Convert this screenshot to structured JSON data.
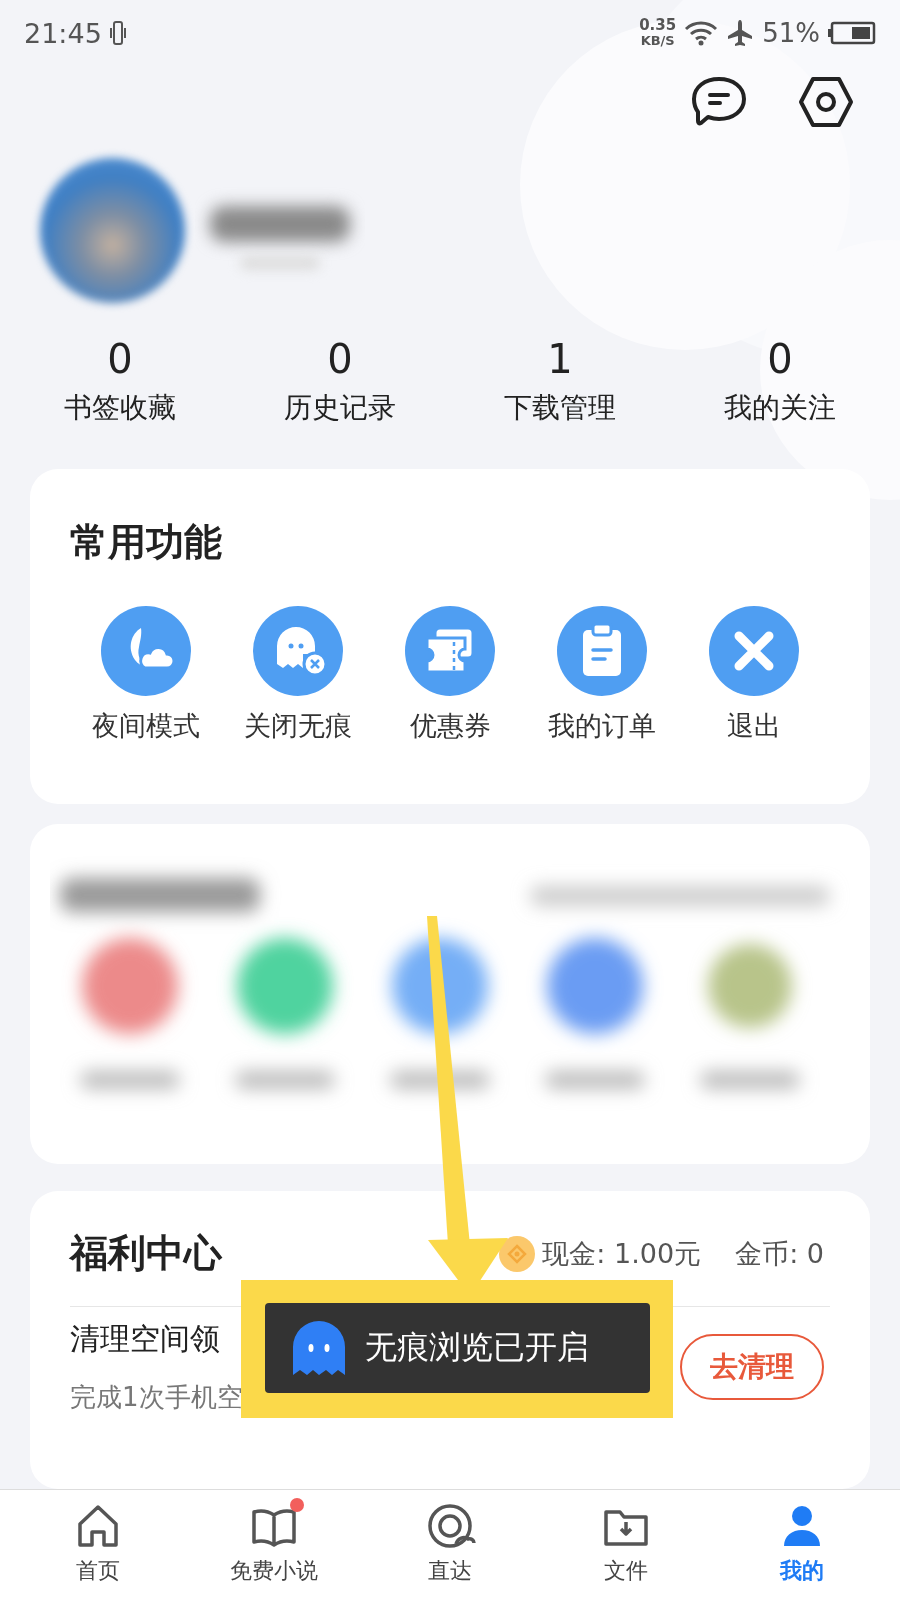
{
  "status_bar": {
    "time": "21:45",
    "net_speed": "0.35",
    "net_unit": "KB/S",
    "battery": "51%"
  },
  "stats": [
    {
      "value": "0",
      "label": "书签收藏"
    },
    {
      "value": "0",
      "label": "历史记录"
    },
    {
      "value": "1",
      "label": "下载管理"
    },
    {
      "value": "0",
      "label": "我的关注"
    }
  ],
  "common_functions": {
    "title": "常用功能",
    "items": [
      {
        "label": "夜间模式"
      },
      {
        "label": "关闭无痕"
      },
      {
        "label": "优惠券"
      },
      {
        "label": "我的订单"
      },
      {
        "label": "退出"
      }
    ]
  },
  "welfare": {
    "title": "福利中心",
    "cash": "现金: 1.00元",
    "coins": "金币: 0",
    "task": {
      "title": "清理空间领",
      "subtitle": "完成1次手机空",
      "button": "去清理"
    }
  },
  "toast": {
    "text": "无痕浏览已开启"
  },
  "nav": [
    {
      "label": "首页",
      "selected": false,
      "badge": false
    },
    {
      "label": "免费小说",
      "selected": false,
      "badge": true
    },
    {
      "label": "直达",
      "selected": false,
      "badge": false
    },
    {
      "label": "文件",
      "selected": false,
      "badge": false
    },
    {
      "label": "我的",
      "selected": true,
      "badge": false
    }
  ]
}
